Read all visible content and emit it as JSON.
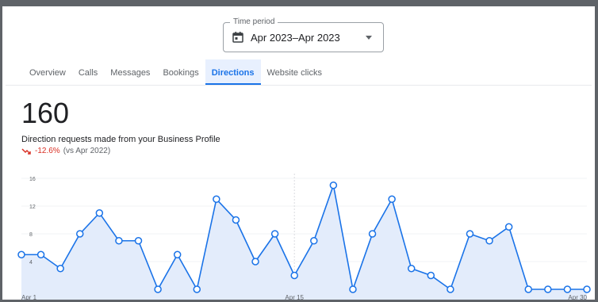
{
  "time_period": {
    "label": "Time period",
    "value": "Apr 2023–Apr 2023"
  },
  "tabs": [
    {
      "label": "Overview",
      "active": false
    },
    {
      "label": "Calls",
      "active": false
    },
    {
      "label": "Messages",
      "active": false
    },
    {
      "label": "Bookings",
      "active": false
    },
    {
      "label": "Directions",
      "active": true
    },
    {
      "label": "Website clicks",
      "active": false
    }
  ],
  "metric": {
    "value": "160",
    "description": "Direction requests made from your Business Profile",
    "change_pct": "-12.6%",
    "comparison": "(vs Apr 2022)"
  },
  "colors": {
    "accent": "#1a73e8",
    "area_fill": "#e3ecfb",
    "negative": "#d93025"
  },
  "chart_data": {
    "type": "area",
    "x": [
      "Apr 1",
      "Apr 2",
      "Apr 3",
      "Apr 4",
      "Apr 5",
      "Apr 6",
      "Apr 7",
      "Apr 8",
      "Apr 9",
      "Apr 10",
      "Apr 11",
      "Apr 12",
      "Apr 13",
      "Apr 14",
      "Apr 15",
      "Apr 16",
      "Apr 17",
      "Apr 18",
      "Apr 19",
      "Apr 20",
      "Apr 21",
      "Apr 22",
      "Apr 23",
      "Apr 24",
      "Apr 25",
      "Apr 26",
      "Apr 27",
      "Apr 28",
      "Apr 29",
      "Apr 30"
    ],
    "series": [
      {
        "values": [
          5,
          5,
          3,
          8,
          11,
          7,
          7,
          0,
          5,
          0,
          13,
          10,
          4,
          8,
          2,
          7,
          15,
          0,
          8,
          13,
          3,
          2,
          0,
          8,
          7,
          9,
          0,
          0,
          0,
          0
        ]
      }
    ],
    "x_tick_labels": [
      "Apr 1",
      "Apr 15",
      "Apr 30"
    ],
    "y_tick_labels": [
      "4",
      "8",
      "12",
      "16"
    ],
    "ylim": [
      0,
      16
    ],
    "grid": true
  }
}
